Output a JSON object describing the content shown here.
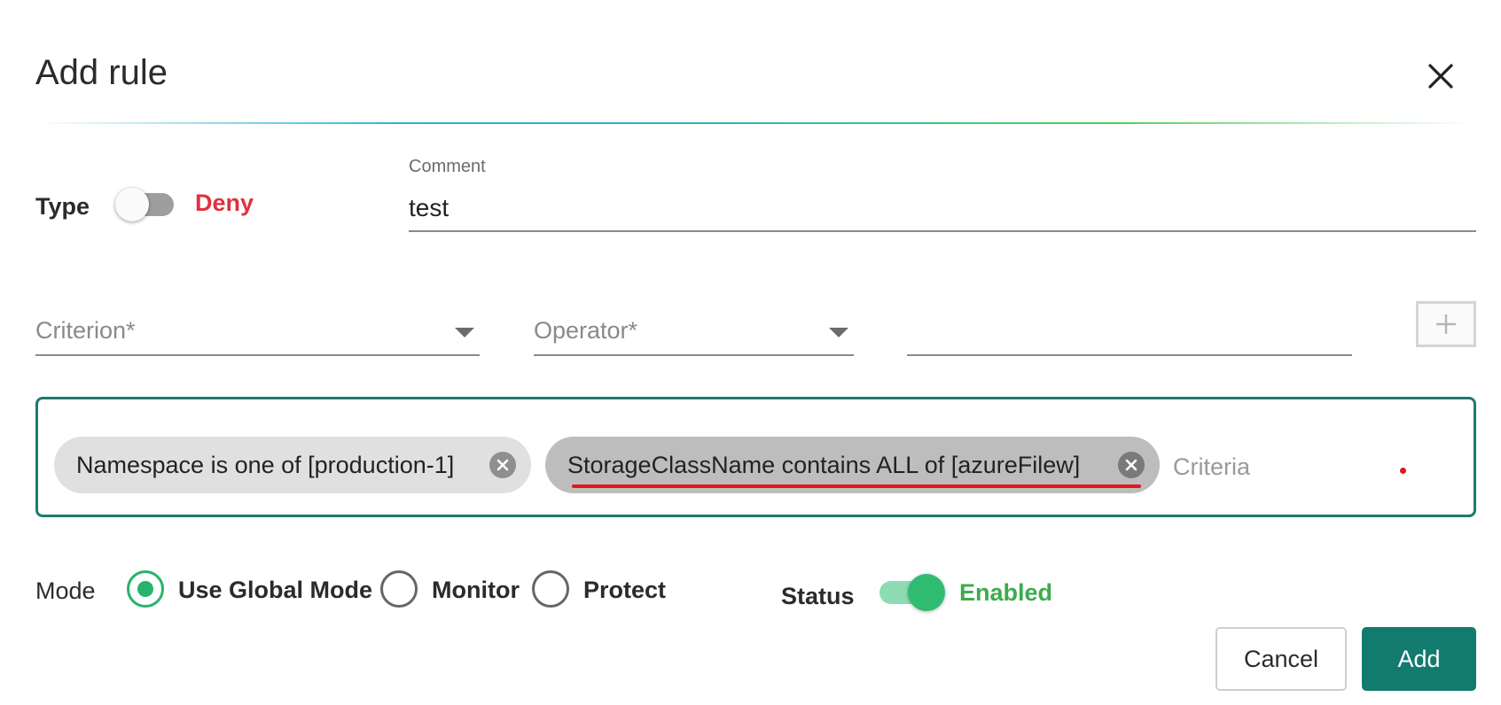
{
  "dialog": {
    "title": "Add rule",
    "close_icon": "close-icon"
  },
  "type": {
    "label": "Type",
    "toggle_on": false,
    "value": "Deny",
    "value_color": "#e0313f"
  },
  "comment": {
    "label": "Comment",
    "value": "test"
  },
  "criterion_form": {
    "criterion_placeholder": "Criterion*",
    "operator_placeholder": "Operator*",
    "value": "",
    "add_icon": "plus-icon"
  },
  "criteria": {
    "chips": [
      {
        "label": "Namespace is one of [production-1]",
        "remove_icon": "cancel-circle-icon"
      },
      {
        "label": "StorageClassName contains ALL of [azureFilew]",
        "remove_icon": "cancel-circle-icon",
        "highlighted": true
      }
    ],
    "input_placeholder": "Criteria",
    "border_color": "#1e7a72"
  },
  "mode": {
    "label": "Mode",
    "options": [
      {
        "label": "Use Global Mode",
        "checked": true
      },
      {
        "label": "Monitor",
        "checked": false
      },
      {
        "label": "Protect",
        "checked": false
      }
    ],
    "accent_color": "#27b36b"
  },
  "status": {
    "label": "Status",
    "toggle_on": true,
    "value": "Enabled",
    "value_color": "#3cac4e"
  },
  "actions": {
    "cancel_label": "Cancel",
    "add_label": "Add",
    "primary_color": "#137a6e"
  }
}
